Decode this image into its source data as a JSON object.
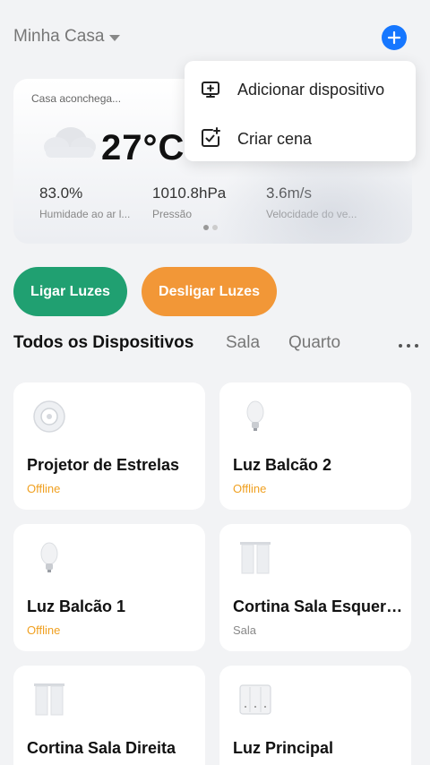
{
  "header": {
    "home_name": "Minha Casa"
  },
  "weather": {
    "home_label": "Casa aconchega...",
    "temperature": "27°C",
    "stats": [
      {
        "value": "83.0%",
        "label": "Humidade ao ar l..."
      },
      {
        "value": "1010.8hPa",
        "label": "Pressão"
      },
      {
        "value": "3.6m/s",
        "label": "Velocidade do ve..."
      }
    ]
  },
  "scenes": {
    "on_label": "Ligar Luzes",
    "off_label": "Desligar Luzes"
  },
  "tabs": [
    {
      "label": "Todos os Dispositivos",
      "active": true
    },
    {
      "label": "Sala",
      "active": false
    },
    {
      "label": "Quarto",
      "active": false
    }
  ],
  "devices": [
    {
      "name": "Projetor de Estrelas",
      "status": "Offline",
      "icon": "star-projector-icon"
    },
    {
      "name": "Luz Balcão 2",
      "status": "Offline",
      "icon": "light-bulb-icon"
    },
    {
      "name": "Luz Balcão 1",
      "status": "Offline",
      "icon": "light-bulb-icon"
    },
    {
      "name": "Cortina Sala Esquerda",
      "status": "Sala",
      "icon": "curtain-icon"
    },
    {
      "name": "Cortina Sala Direita",
      "status": "",
      "icon": "curtain-icon"
    },
    {
      "name": "Luz Principal",
      "status": "",
      "icon": "wall-switch-icon"
    }
  ],
  "popup_menu": {
    "items": [
      {
        "label": "Adicionar dispositivo",
        "icon": "add-device-icon"
      },
      {
        "label": "Criar cena",
        "icon": "create-scene-icon"
      }
    ]
  },
  "colors": {
    "accent": "#1677ff",
    "on_scene": "#20a071",
    "off_scene": "#f29737",
    "offline": "#f0a020"
  }
}
